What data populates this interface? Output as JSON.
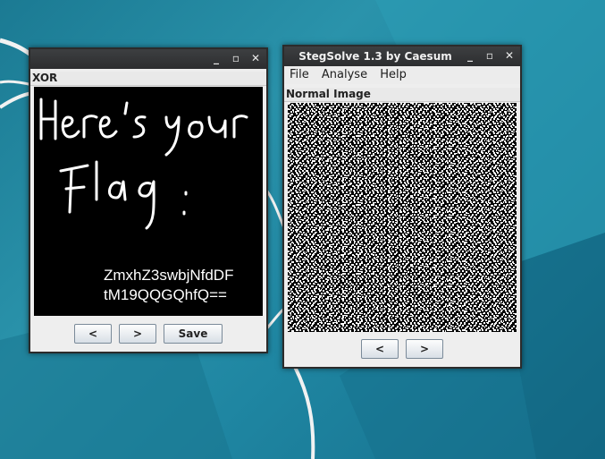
{
  "colors": {
    "desktop": "#1f86a2",
    "titlebar": "#2f3032",
    "window_bg": "#eeeeee"
  },
  "xor_window": {
    "panel_label": "XOR",
    "window_controls": [
      "minimize-icon",
      "maximize-icon",
      "close-icon"
    ],
    "flag_text_lines": [
      "ZmxhZ3swbjNfdDF",
      "tM19QQGQhfQ=="
    ],
    "buttons": {
      "prev": "<",
      "next": ">",
      "save": "Save"
    }
  },
  "stegsolve_window": {
    "title": "StegSolve 1.3 by Caesum",
    "window_controls": [
      "minimize-icon",
      "maximize-icon",
      "close-icon"
    ],
    "menu": [
      "File",
      "Analyse",
      "Help"
    ],
    "panel_label": "Normal Image",
    "buttons": {
      "prev": "<",
      "next": ">"
    }
  }
}
